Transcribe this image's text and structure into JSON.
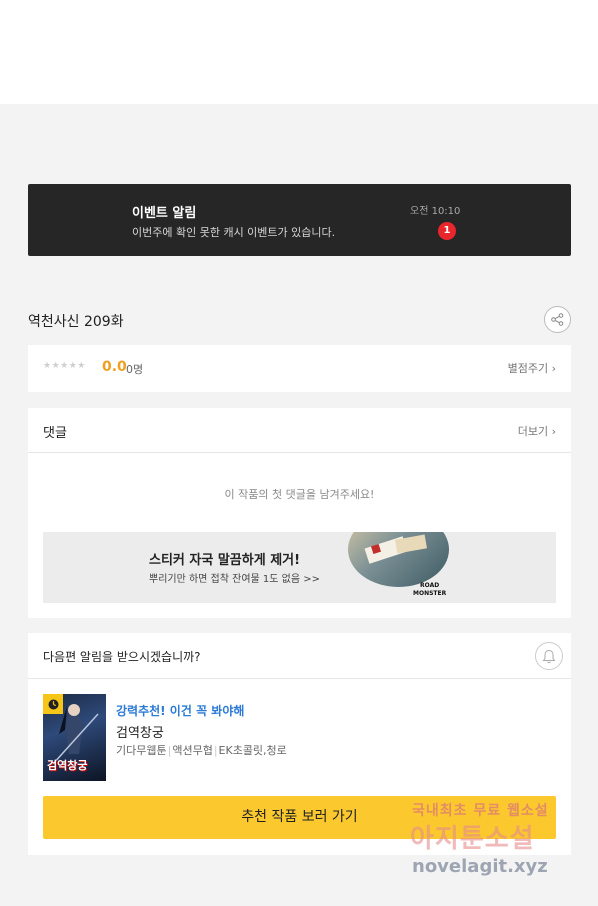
{
  "event": {
    "title": "이벤트 알림",
    "description": "이번주에 확인 못한 캐시 이벤트가 있습니다.",
    "time": "오전 10:10",
    "badge_count": "1"
  },
  "episode": {
    "title": "역천사신 209화"
  },
  "rating": {
    "stars": "★★★★★",
    "value": "0.0",
    "count": "0명",
    "rate_link": "별점주기"
  },
  "comments": {
    "title": "댓글",
    "more_link": "더보기",
    "empty_message": "이 작품의 첫 댓글을 남겨주세요!"
  },
  "ad": {
    "title": "스티커 자국 말끔하게 제거!",
    "subtitle": "뿌리기만 하면 접착 잔여물 1도 없음 >>",
    "logo_line1": "ROAD",
    "logo_line2": "MONSTER"
  },
  "next_episode": {
    "question": "다음편 알림을 받으시겠습니까?"
  },
  "recommendation": {
    "tag": "강력추천! 이건 꼭 봐야해",
    "work_title": "검역창궁",
    "thumb_title": "검역창궁",
    "genre1": "기다무웹툰",
    "genre2": "액션무협",
    "creators": "EK초콜릿,청로",
    "cta_label": "추천 작품 보러 가기"
  },
  "watermark": {
    "line1": "국내최초 무료 웹소설",
    "line2": "아지툰소설",
    "line3": "novelagit.xyz"
  },
  "colors": {
    "accent_yellow": "#fbc92e",
    "rating_orange": "#f0a020",
    "badge_red": "#e8262c",
    "link_blue": "#2a7ad6"
  }
}
